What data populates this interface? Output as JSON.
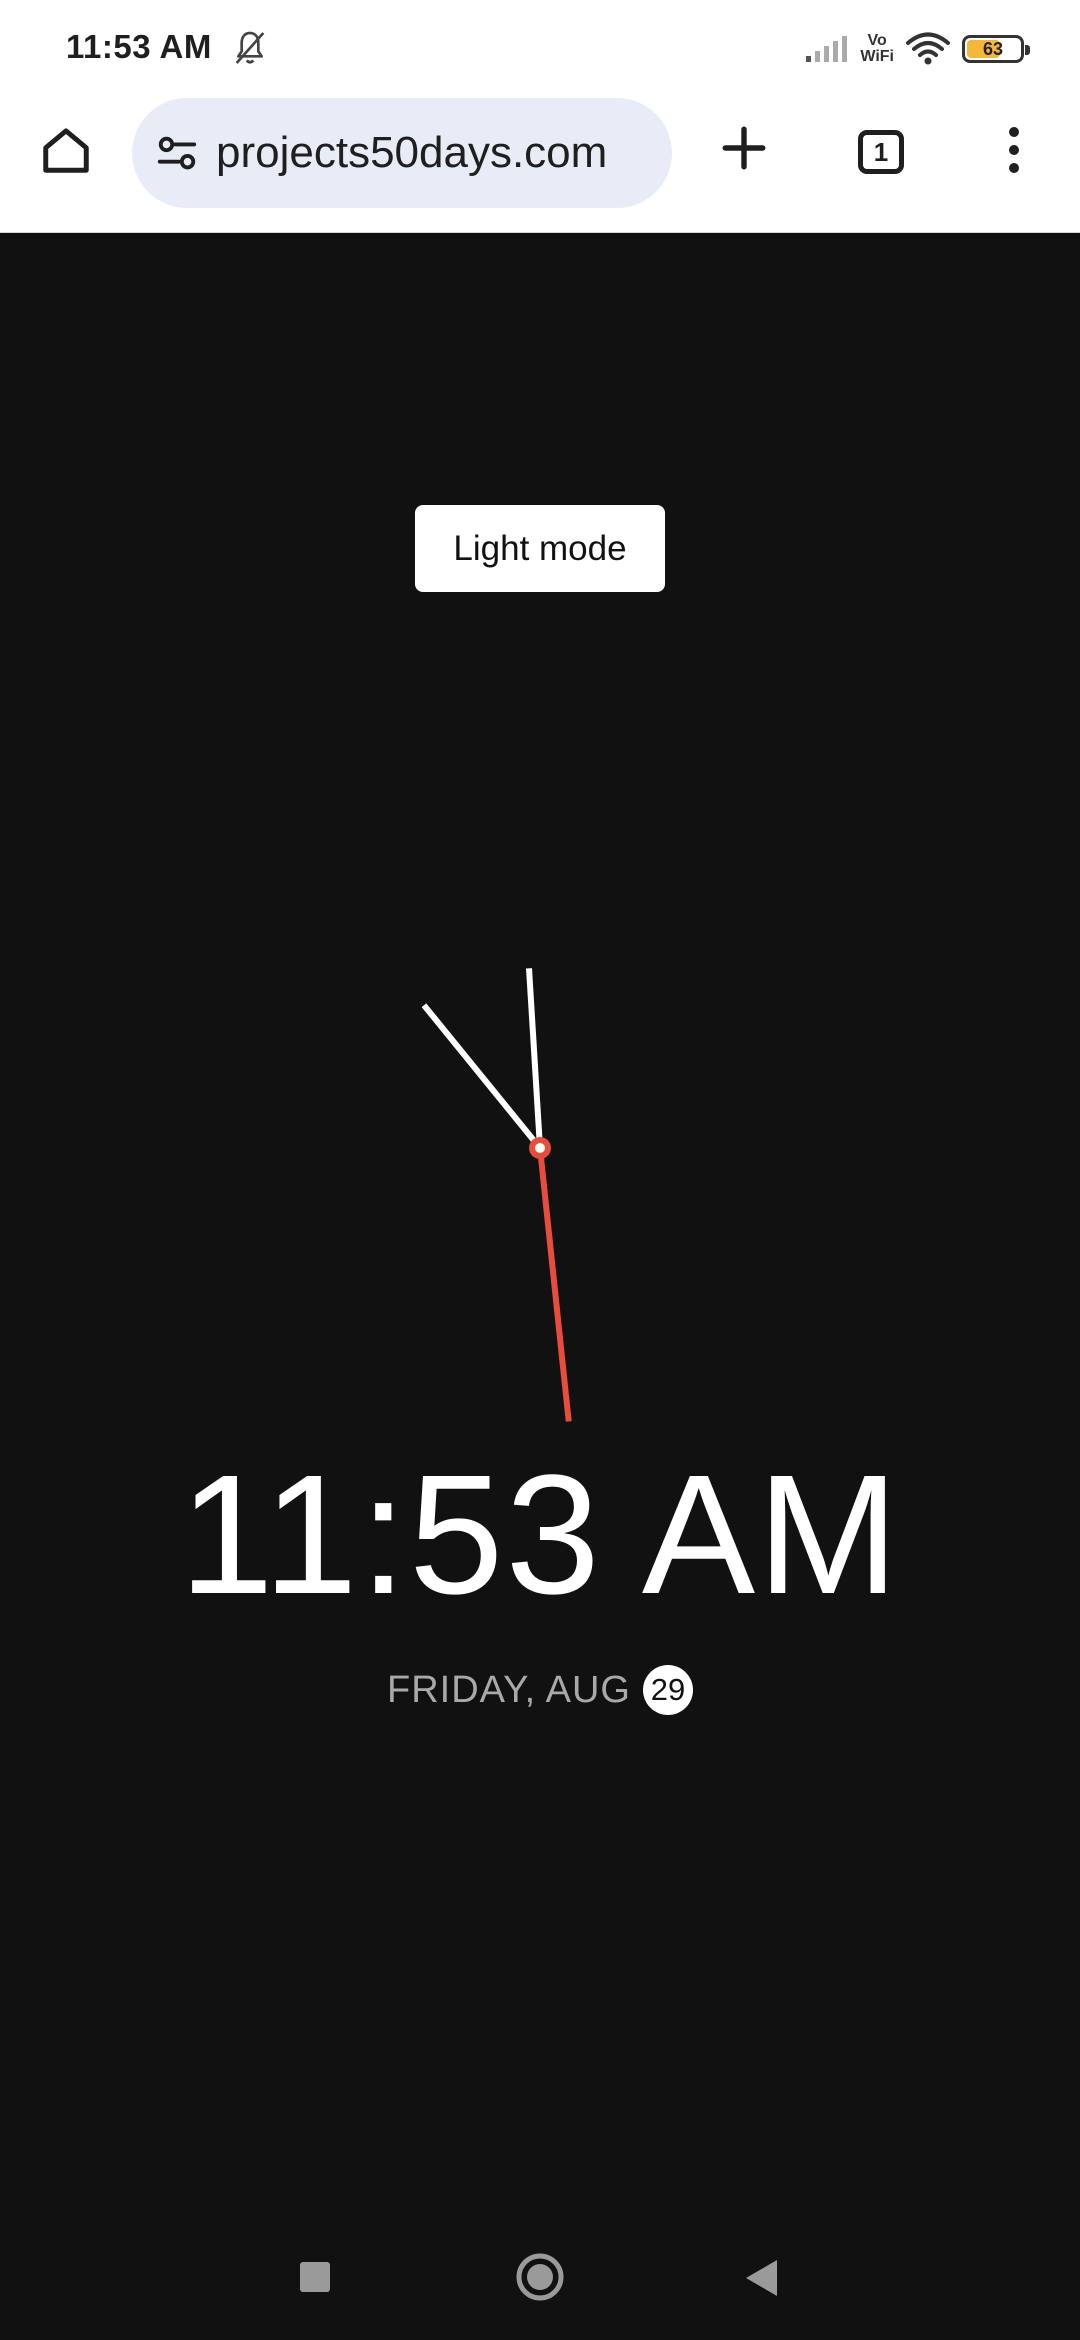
{
  "status_bar": {
    "time": "11:53 AM",
    "vowifi_line1": "Vo",
    "vowifi_line2": "WiFi",
    "battery_level": "63",
    "battery_fraction": 0.63,
    "icons": [
      "bell-off-icon",
      "signal-icon",
      "wifi-icon",
      "battery-icon"
    ]
  },
  "browser": {
    "url": "projects50days.com",
    "tab_count": "1",
    "icons": [
      "home-icon",
      "site-settings-icon",
      "plus-icon",
      "tabs-icon",
      "more-vert-icon"
    ]
  },
  "page": {
    "toggle_label": "Light mode",
    "digital_time": "11:53 AM",
    "date_text": "FRIDAY, AUG",
    "date_day": "29",
    "clock": {
      "hours": 11,
      "minutes": 53,
      "seconds": 29
    },
    "colors": {
      "background": "#111112",
      "hands": "#ffffff",
      "second_hand": "#e74c3c"
    }
  },
  "nav_bar": {
    "icons": [
      "recents-icon",
      "home-circle-icon",
      "back-icon"
    ]
  }
}
